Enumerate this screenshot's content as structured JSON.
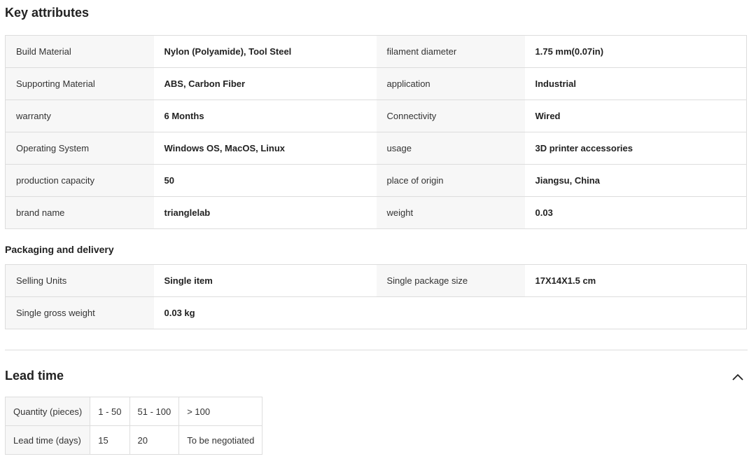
{
  "key_attributes": {
    "title": "Key attributes",
    "rows": [
      [
        {
          "k": "Build Material",
          "v": "Nylon (Polyamide), Tool Steel"
        },
        {
          "k": "filament diameter",
          "v": "1.75 mm(0.07in)"
        }
      ],
      [
        {
          "k": "Supporting Material",
          "v": "ABS, Carbon Fiber"
        },
        {
          "k": "application",
          "v": "Industrial"
        }
      ],
      [
        {
          "k": "warranty",
          "v": "6 Months"
        },
        {
          "k": "Connectivity",
          "v": "Wired"
        }
      ],
      [
        {
          "k": "Operating System",
          "v": "Windows OS, MacOS, Linux"
        },
        {
          "k": "usage",
          "v": "3D printer accessories"
        }
      ],
      [
        {
          "k": "production capacity",
          "v": "50"
        },
        {
          "k": "place of origin",
          "v": "Jiangsu, China"
        }
      ],
      [
        {
          "k": "brand name",
          "v": "trianglelab"
        },
        {
          "k": "weight",
          "v": "0.03"
        }
      ]
    ]
  },
  "packaging": {
    "title": "Packaging and delivery",
    "rows": [
      [
        {
          "k": "Selling Units",
          "v": "Single item"
        },
        {
          "k": "Single package size",
          "v": "17X14X1.5 cm"
        }
      ],
      [
        {
          "k": "Single gross weight",
          "v": "0.03 kg"
        },
        {
          "k": "",
          "v": ""
        }
      ]
    ]
  },
  "lead_time": {
    "title": "Lead time",
    "collapse_icon": "chevron-up-icon",
    "header": [
      "Quantity (pieces)",
      "1 - 50",
      "51 - 100",
      "> 100"
    ],
    "values": [
      "Lead time (days)",
      "15",
      "20",
      "To be negotiated"
    ]
  }
}
